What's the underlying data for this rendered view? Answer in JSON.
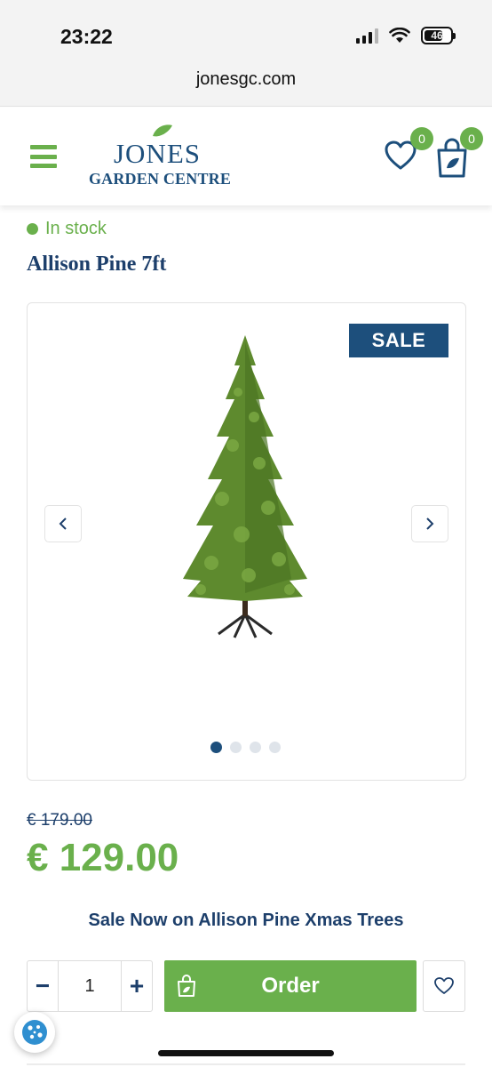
{
  "status_bar": {
    "time": "23:22",
    "battery": "46"
  },
  "browser": {
    "url": "jonesgc.com"
  },
  "header": {
    "logo_main": "JONES",
    "logo_sub": "GARDEN CENTRE",
    "wishlist_count": "0",
    "cart_count": "0",
    "icons": [
      "menu-icon",
      "heart-icon",
      "shopping-bag-icon"
    ]
  },
  "product": {
    "stock_status": "In stock",
    "title": "Allison Pine 7ft",
    "sale_badge": "SALE",
    "gallery_total_images": 4,
    "gallery_active_index": 0,
    "old_price": "€ 179.00",
    "price": "€ 129.00",
    "promo_text": "Sale Now on Allison Pine Xmas Trees"
  },
  "purchase": {
    "minus_label": "−",
    "plus_label": "+",
    "quantity": "1",
    "order_label": "Order"
  },
  "colors": {
    "brand_green": "#6ab04c",
    "brand_blue": "#1d4f7c",
    "text_navy": "#1d3f6b"
  }
}
